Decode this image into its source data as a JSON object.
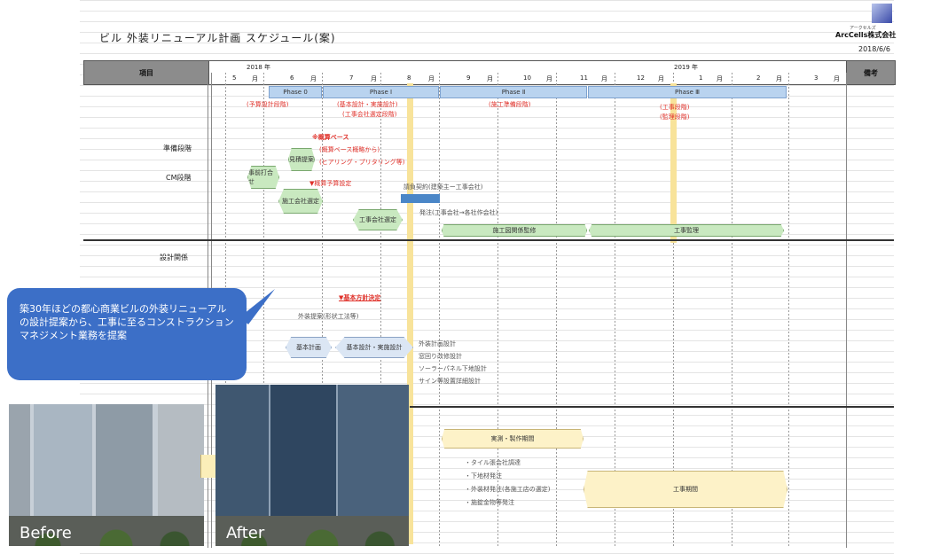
{
  "title": "ビル 外装リニューアル計画 スケジュール(案)",
  "logo": {
    "subtitle": "アークセルズ",
    "name": "ArcCells株式会社"
  },
  "date": "2018/6/6",
  "header": {
    "item_label": "項目",
    "notes_label": "備考",
    "years": [
      "2018 年",
      "2019 年"
    ],
    "months": [
      "5",
      "月",
      "6",
      "月",
      "7",
      "月",
      "8",
      "月",
      "9",
      "月",
      "10",
      "月",
      "11",
      "月",
      "12",
      "月",
      "1",
      "月",
      "2",
      "月",
      "3",
      "月"
    ]
  },
  "sections": {
    "prep": "準備段階",
    "cm": "CM段階",
    "design": "設計関係"
  },
  "phases": [
    "Phase 0",
    "Phase Ⅰ",
    "Phase Ⅱ",
    "Phase Ⅲ"
  ],
  "phase_notes": {
    "p0": "(予算設計段階)",
    "p1a": "(基本設計・実施設計)",
    "p1b": "(工事会社選定段階)",
    "p2": "(施工準備段階)",
    "p3a": "(工事段階)",
    "p3b": "(監理段階)"
  },
  "red_notes": {
    "budget_base": "※概算ベース",
    "budget_1": "(概算ベース概略から)",
    "budget_2": "(ヒアリング・プリタリング等)",
    "budget_setting": "▼概算予算設定",
    "policy": "▼基本方針決定"
  },
  "tasks": {
    "proposal": "見積提案",
    "meeting": "事前打合せ",
    "selection": "施工会社選定",
    "contractor": "工事会社選定",
    "contract": "請負契約(建築主ー工事会社)",
    "order": "発注(工事会社→各社作会社)",
    "construction_coord": "施工図関係監修",
    "supervision": "工事監理",
    "exterior": "外装提案(形状工法等)",
    "basic_plan": "基本計画",
    "design": "基本設計・実施設計",
    "d1": "外装計画設計",
    "d2": "窓回り改修設計",
    "d3": "ソーラーパネル下地設計",
    "d4": "サイン等設置詳細設計",
    "survey": "実測・製作期間",
    "b1": "・タイル張会社調達",
    "b2": "・下地材発注",
    "b3": "・外装材発注(各施工店の選定)",
    "b4": "・施錠金物等発注",
    "construction_period": "工事期間"
  },
  "callout": "築30年ほどの都心商業ビルの外装リニューアルの設計提案から、工事に至るコンストラクションマネジメント業務を提案",
  "photos": {
    "before": "Before",
    "after": "After"
  },
  "colors": {
    "phase_fill": "#b9d3ef",
    "task_green": "#c9e9c0",
    "accent_red": "#e0312a",
    "callout": "#3c6fc7",
    "highlight": "#f8e39a"
  }
}
